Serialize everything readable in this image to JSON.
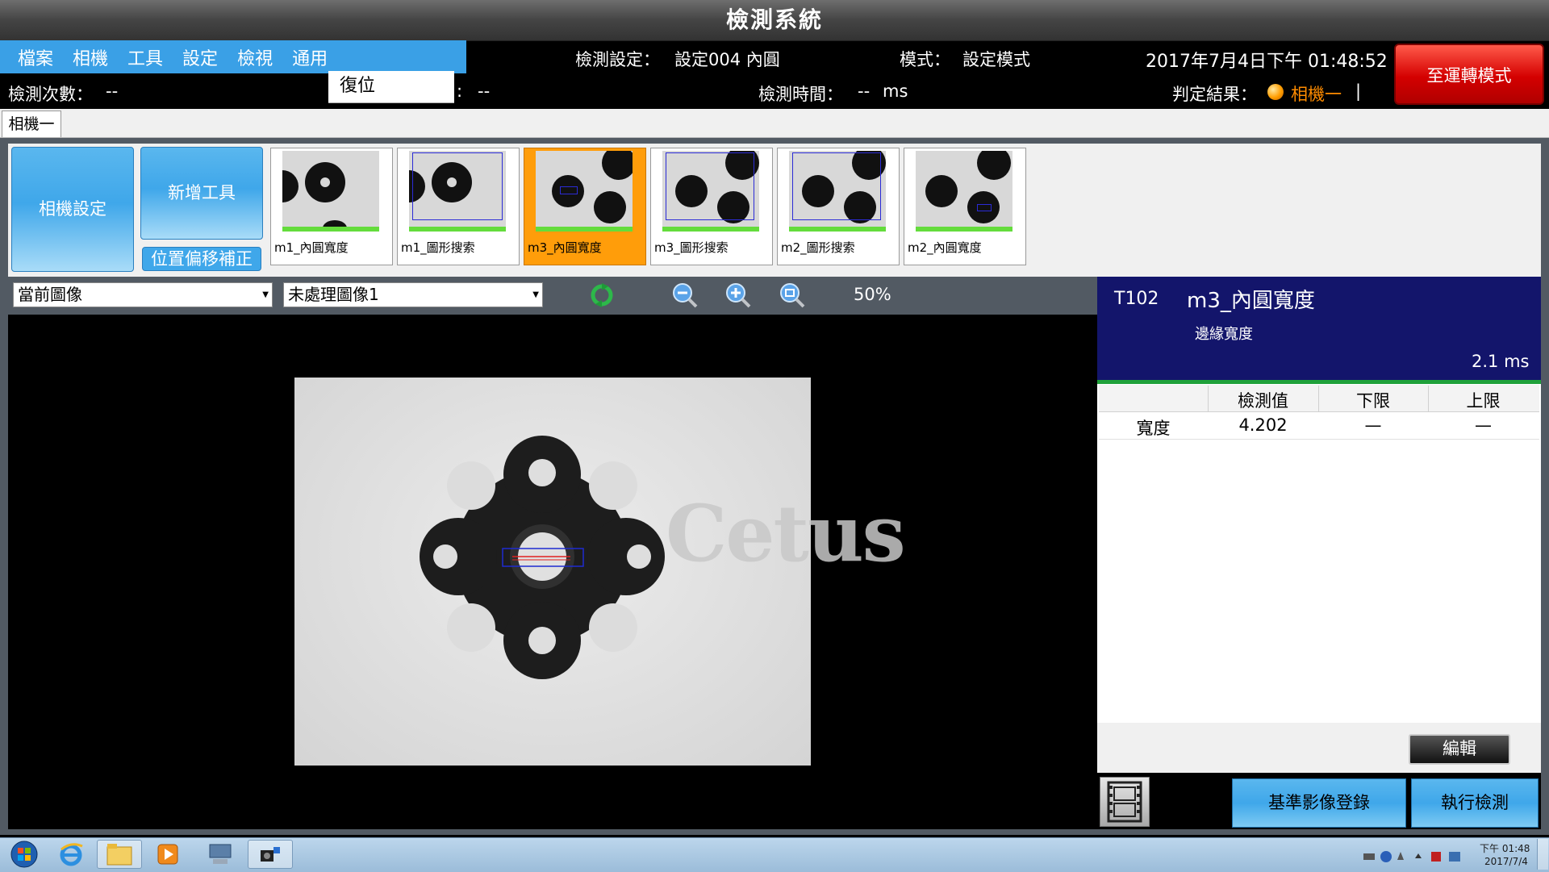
{
  "window": {
    "title": "檢測系統"
  },
  "menu": {
    "items": [
      "檔案",
      "相機",
      "工具",
      "設定",
      "檢視",
      "通用"
    ]
  },
  "status": {
    "config_label": "檢測設定：",
    "config_value": "設定004 內圓",
    "mode_label": "模式：",
    "mode_value": "設定模式",
    "datetime": "2017年7月4日下午 01:48:52",
    "count_label": "檢測次數：",
    "count_value": "--",
    "reset_label": "復位",
    "mid_label": ":",
    "mid_value": "--",
    "time_label": "檢測時間：",
    "time_value": "--",
    "time_unit": "ms",
    "result_label": "判定結果：",
    "result_value": "相機一",
    "result_suffix": "|"
  },
  "run_mode_button": "至運轉模式",
  "tabs": [
    "相機一"
  ],
  "toolbar": {
    "camera_settings": "相機設定",
    "add_tool": "新增工具",
    "offset_correction": "位置偏移補正"
  },
  "tools": [
    {
      "label": "m1_內圓寬度",
      "selected": false
    },
    {
      "label": "m1_圖形搜索",
      "selected": false
    },
    {
      "label": "m3_內圓寬度",
      "selected": true
    },
    {
      "label": "m3_圖形搜索",
      "selected": false
    },
    {
      "label": "m2_圖形搜索",
      "selected": false
    },
    {
      "label": "m2_內圓寬度",
      "selected": false
    }
  ],
  "view": {
    "image_source": "當前圖像",
    "image_type": "未處理圖像1",
    "zoom": "50%",
    "watermark": "Cetus"
  },
  "tool_info": {
    "id": "T102",
    "name": "m3_內圓寬度",
    "subtitle": "邊緣寬度",
    "time": "2.1 ms"
  },
  "results_table": {
    "headers": [
      "",
      "檢測值",
      "下限",
      "上限"
    ],
    "rows": [
      {
        "name": "寬度",
        "value": "4.202",
        "lower": "—",
        "upper": "—"
      }
    ]
  },
  "buttons": {
    "edit": "編輯",
    "register_reference": "基準影像登錄",
    "run_inspection": "執行檢測"
  },
  "taskbar": {
    "time": "下午 01:48",
    "date": "2017/7/4"
  },
  "colors": {
    "menu_blue": "#3aa0e6",
    "run_red": "#d40000",
    "selected_orange": "#ff9d0a",
    "info_navy": "#13156b",
    "result_orange": "#ff8c00"
  }
}
